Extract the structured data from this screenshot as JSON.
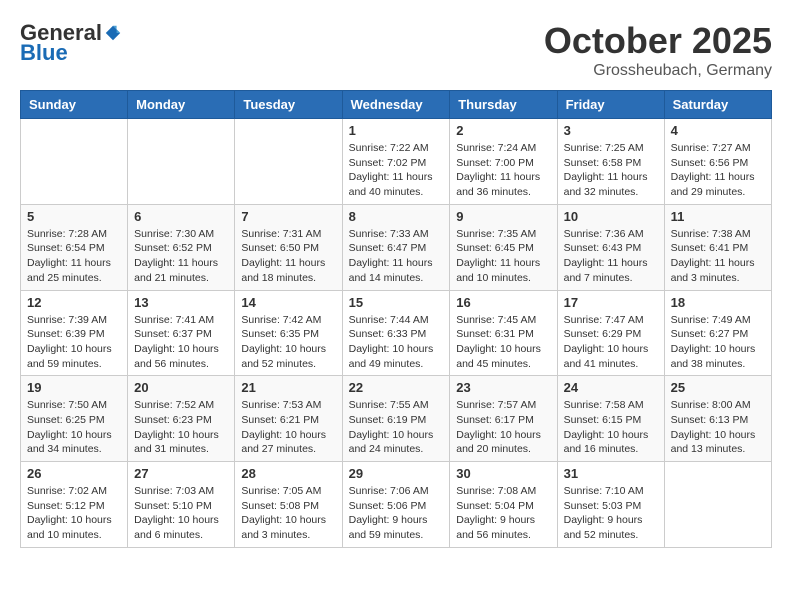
{
  "header": {
    "logo": {
      "general": "General",
      "blue": "Blue",
      "tagline": ""
    },
    "title": "October 2025",
    "location": "Grossheubach, Germany"
  },
  "calendar": {
    "days_of_week": [
      "Sunday",
      "Monday",
      "Tuesday",
      "Wednesday",
      "Thursday",
      "Friday",
      "Saturday"
    ],
    "weeks": [
      [
        {
          "day": "",
          "info": ""
        },
        {
          "day": "",
          "info": ""
        },
        {
          "day": "",
          "info": ""
        },
        {
          "day": "1",
          "info": "Sunrise: 7:22 AM\nSunset: 7:02 PM\nDaylight: 11 hours\nand 40 minutes."
        },
        {
          "day": "2",
          "info": "Sunrise: 7:24 AM\nSunset: 7:00 PM\nDaylight: 11 hours\nand 36 minutes."
        },
        {
          "day": "3",
          "info": "Sunrise: 7:25 AM\nSunset: 6:58 PM\nDaylight: 11 hours\nand 32 minutes."
        },
        {
          "day": "4",
          "info": "Sunrise: 7:27 AM\nSunset: 6:56 PM\nDaylight: 11 hours\nand 29 minutes."
        }
      ],
      [
        {
          "day": "5",
          "info": "Sunrise: 7:28 AM\nSunset: 6:54 PM\nDaylight: 11 hours\nand 25 minutes."
        },
        {
          "day": "6",
          "info": "Sunrise: 7:30 AM\nSunset: 6:52 PM\nDaylight: 11 hours\nand 21 minutes."
        },
        {
          "day": "7",
          "info": "Sunrise: 7:31 AM\nSunset: 6:50 PM\nDaylight: 11 hours\nand 18 minutes."
        },
        {
          "day": "8",
          "info": "Sunrise: 7:33 AM\nSunset: 6:47 PM\nDaylight: 11 hours\nand 14 minutes."
        },
        {
          "day": "9",
          "info": "Sunrise: 7:35 AM\nSunset: 6:45 PM\nDaylight: 11 hours\nand 10 minutes."
        },
        {
          "day": "10",
          "info": "Sunrise: 7:36 AM\nSunset: 6:43 PM\nDaylight: 11 hours\nand 7 minutes."
        },
        {
          "day": "11",
          "info": "Sunrise: 7:38 AM\nSunset: 6:41 PM\nDaylight: 11 hours\nand 3 minutes."
        }
      ],
      [
        {
          "day": "12",
          "info": "Sunrise: 7:39 AM\nSunset: 6:39 PM\nDaylight: 10 hours\nand 59 minutes."
        },
        {
          "day": "13",
          "info": "Sunrise: 7:41 AM\nSunset: 6:37 PM\nDaylight: 10 hours\nand 56 minutes."
        },
        {
          "day": "14",
          "info": "Sunrise: 7:42 AM\nSunset: 6:35 PM\nDaylight: 10 hours\nand 52 minutes."
        },
        {
          "day": "15",
          "info": "Sunrise: 7:44 AM\nSunset: 6:33 PM\nDaylight: 10 hours\nand 49 minutes."
        },
        {
          "day": "16",
          "info": "Sunrise: 7:45 AM\nSunset: 6:31 PM\nDaylight: 10 hours\nand 45 minutes."
        },
        {
          "day": "17",
          "info": "Sunrise: 7:47 AM\nSunset: 6:29 PM\nDaylight: 10 hours\nand 41 minutes."
        },
        {
          "day": "18",
          "info": "Sunrise: 7:49 AM\nSunset: 6:27 PM\nDaylight: 10 hours\nand 38 minutes."
        }
      ],
      [
        {
          "day": "19",
          "info": "Sunrise: 7:50 AM\nSunset: 6:25 PM\nDaylight: 10 hours\nand 34 minutes."
        },
        {
          "day": "20",
          "info": "Sunrise: 7:52 AM\nSunset: 6:23 PM\nDaylight: 10 hours\nand 31 minutes."
        },
        {
          "day": "21",
          "info": "Sunrise: 7:53 AM\nSunset: 6:21 PM\nDaylight: 10 hours\nand 27 minutes."
        },
        {
          "day": "22",
          "info": "Sunrise: 7:55 AM\nSunset: 6:19 PM\nDaylight: 10 hours\nand 24 minutes."
        },
        {
          "day": "23",
          "info": "Sunrise: 7:57 AM\nSunset: 6:17 PM\nDaylight: 10 hours\nand 20 minutes."
        },
        {
          "day": "24",
          "info": "Sunrise: 7:58 AM\nSunset: 6:15 PM\nDaylight: 10 hours\nand 16 minutes."
        },
        {
          "day": "25",
          "info": "Sunrise: 8:00 AM\nSunset: 6:13 PM\nDaylight: 10 hours\nand 13 minutes."
        }
      ],
      [
        {
          "day": "26",
          "info": "Sunrise: 7:02 AM\nSunset: 5:12 PM\nDaylight: 10 hours\nand 10 minutes."
        },
        {
          "day": "27",
          "info": "Sunrise: 7:03 AM\nSunset: 5:10 PM\nDaylight: 10 hours\nand 6 minutes."
        },
        {
          "day": "28",
          "info": "Sunrise: 7:05 AM\nSunset: 5:08 PM\nDaylight: 10 hours\nand 3 minutes."
        },
        {
          "day": "29",
          "info": "Sunrise: 7:06 AM\nSunset: 5:06 PM\nDaylight: 9 hours\nand 59 minutes."
        },
        {
          "day": "30",
          "info": "Sunrise: 7:08 AM\nSunset: 5:04 PM\nDaylight: 9 hours\nand 56 minutes."
        },
        {
          "day": "31",
          "info": "Sunrise: 7:10 AM\nSunset: 5:03 PM\nDaylight: 9 hours\nand 52 minutes."
        },
        {
          "day": "",
          "info": ""
        }
      ]
    ]
  }
}
